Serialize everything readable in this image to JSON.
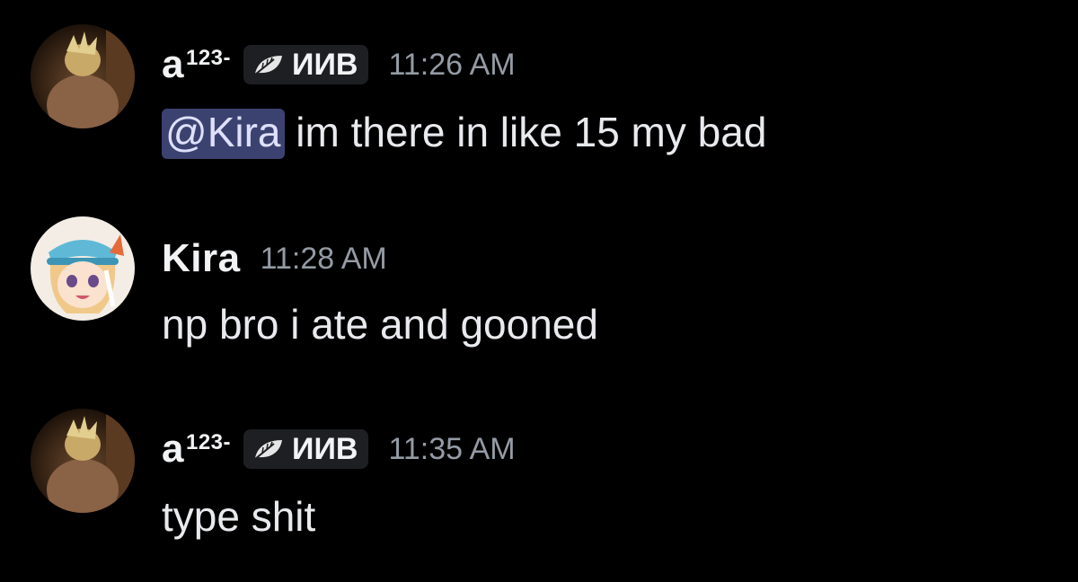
{
  "colors": {
    "background": "#000000",
    "mention_bg": "#3c4270",
    "timestamp": "#949ba4",
    "tag_bg": "#1e1f22"
  },
  "messages": [
    {
      "username": "a",
      "username_sup": "123-",
      "tag": "ИИВ",
      "tag_icon": "leaf-icon",
      "timestamp": "11:26 AM",
      "mention": "@Kira",
      "text": " im there in like 15 my bad"
    },
    {
      "username": "Kira",
      "timestamp": "11:28 AM",
      "text": "np bro i ate and gooned"
    },
    {
      "username": "a",
      "username_sup": "123-",
      "tag": "ИИВ",
      "tag_icon": "leaf-icon",
      "timestamp": "11:35 AM",
      "text": "type shit"
    }
  ]
}
